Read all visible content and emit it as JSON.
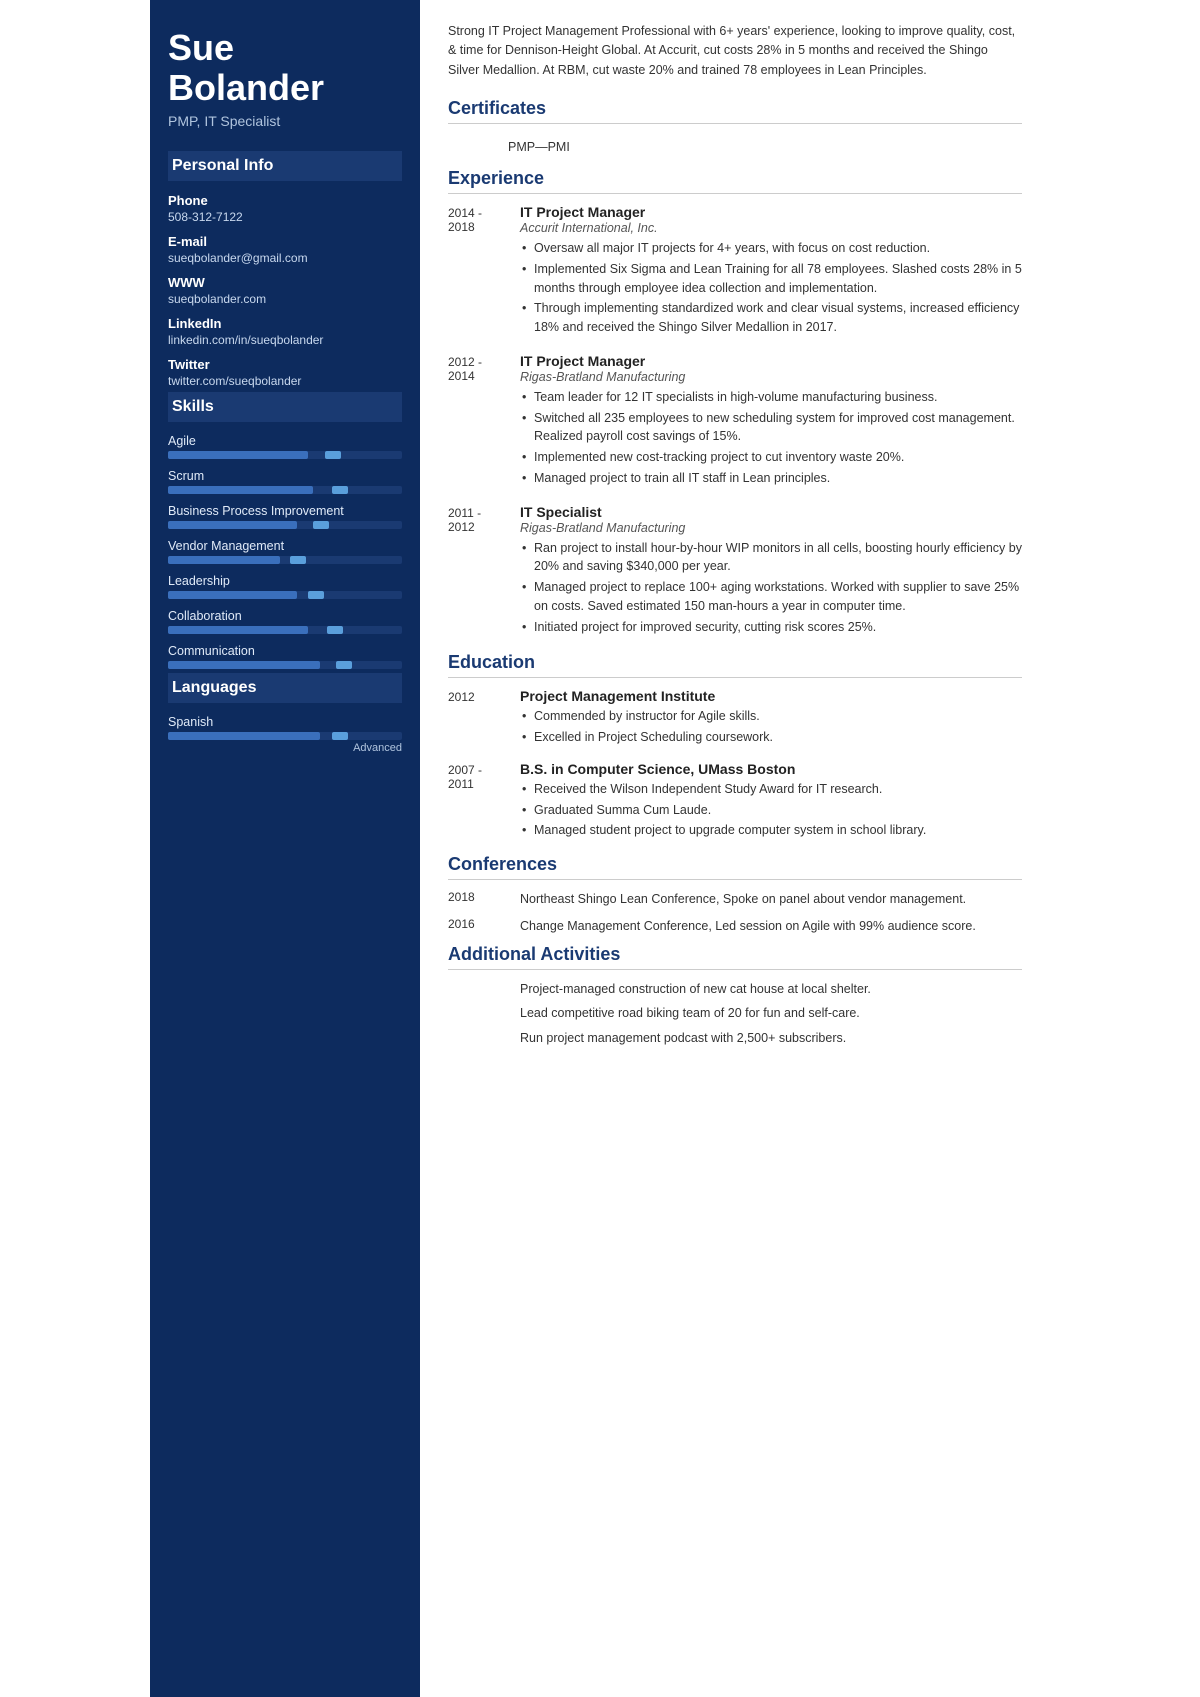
{
  "sidebar": {
    "name_line1": "Sue",
    "name_line2": "Bolander",
    "title": "PMP, IT Specialist",
    "personal_info_label": "Personal Info",
    "phone_label": "Phone",
    "phone_value": "508-312-7122",
    "email_label": "E-mail",
    "email_value": "sueqbolander@gmail.com",
    "www_label": "WWW",
    "www_value": "sueqbolander.com",
    "linkedin_label": "LinkedIn",
    "linkedin_value": "linkedin.com/in/sueqbolander",
    "twitter_label": "Twitter",
    "twitter_value": "twitter.com/sueqbolander",
    "skills_label": "Skills",
    "skills": [
      {
        "name": "Agile",
        "fill_pct": 60,
        "dot_pct": 75
      },
      {
        "name": "Scrum",
        "fill_pct": 62,
        "dot_pct": 78
      },
      {
        "name": "Business Process Improvement",
        "fill_pct": 55,
        "dot_pct": 70
      },
      {
        "name": "Vendor Management",
        "fill_pct": 48,
        "dot_pct": 60
      },
      {
        "name": "Leadership",
        "fill_pct": 55,
        "dot_pct": 68
      },
      {
        "name": "Collaboration",
        "fill_pct": 60,
        "dot_pct": 76
      },
      {
        "name": "Communication",
        "fill_pct": 65,
        "dot_pct": 80
      }
    ],
    "languages_label": "Languages",
    "languages": [
      {
        "name": "Spanish",
        "fill_pct": 65,
        "dot_pct": 78,
        "level": "Advanced"
      }
    ]
  },
  "main": {
    "summary": "Strong IT Project Management Professional with 6+ years' experience, looking to improve quality, cost, & time for Dennison-Height Global. At Accurit, cut costs 28% in 5 months and received the Shingo Silver Medallion. At RBM, cut waste 20% and trained 78 employees in Lean Principles.",
    "certificates_label": "Certificates",
    "certificates": [
      {
        "value": "PMP—PMI"
      }
    ],
    "experience_label": "Experience",
    "experience": [
      {
        "date": "2014 -\n2018",
        "title": "IT Project Manager",
        "company": "Accurit International, Inc.",
        "bullets": [
          "Oversaw all major IT projects for 4+ years, with focus on cost reduction.",
          "Implemented Six Sigma and Lean Training for all 78 employees. Slashed costs 28% in 5 months through employee idea collection and implementation.",
          "Through implementing standardized work and clear visual systems, increased efficiency 18% and received the Shingo Silver Medallion in 2017."
        ]
      },
      {
        "date": "2012 -\n2014",
        "title": "IT Project Manager",
        "company": "Rigas-Bratland Manufacturing",
        "bullets": [
          "Team leader for 12 IT specialists in high-volume manufacturing business.",
          "Switched all 235 employees to new scheduling system for improved cost management. Realized payroll cost savings of 15%.",
          "Implemented new cost-tracking project to cut inventory waste 20%.",
          "Managed project to train all IT staff in Lean principles."
        ]
      },
      {
        "date": "2011 -\n2012",
        "title": "IT Specialist",
        "company": "Rigas-Bratland Manufacturing",
        "bullets": [
          "Ran project to install hour-by-hour WIP monitors in all cells, boosting hourly efficiency by 20% and saving $340,000 per year.",
          "Managed project to replace 100+ aging workstations. Worked with supplier to save 25% on costs. Saved estimated 150 man-hours a year in computer time.",
          "Initiated project for improved security, cutting risk scores 25%."
        ]
      }
    ],
    "education_label": "Education",
    "education": [
      {
        "date": "2012",
        "degree": "Project Management Institute",
        "bullets": [
          "Commended by instructor for Agile skills.",
          "Excelled in Project Scheduling coursework."
        ]
      },
      {
        "date": "2007 -\n2011",
        "degree": "B.S. in Computer Science, UMass Boston",
        "bullets": [
          "Received the Wilson Independent Study Award for IT research.",
          "Graduated Summa Cum Laude.",
          "Managed student project to upgrade computer system in school library."
        ]
      }
    ],
    "conferences_label": "Conferences",
    "conferences": [
      {
        "date": "2018",
        "desc": "Northeast Shingo Lean Conference, Spoke on panel about vendor management."
      },
      {
        "date": "2016",
        "desc": "Change Management Conference, Led session on Agile with 99% audience score."
      }
    ],
    "activities_label": "Additional Activities",
    "activities": [
      "Project-managed construction of new cat house at local shelter.",
      "Lead competitive road biking team of 20 for fun and self-care.",
      "Run project management podcast with 2,500+ subscribers."
    ]
  }
}
